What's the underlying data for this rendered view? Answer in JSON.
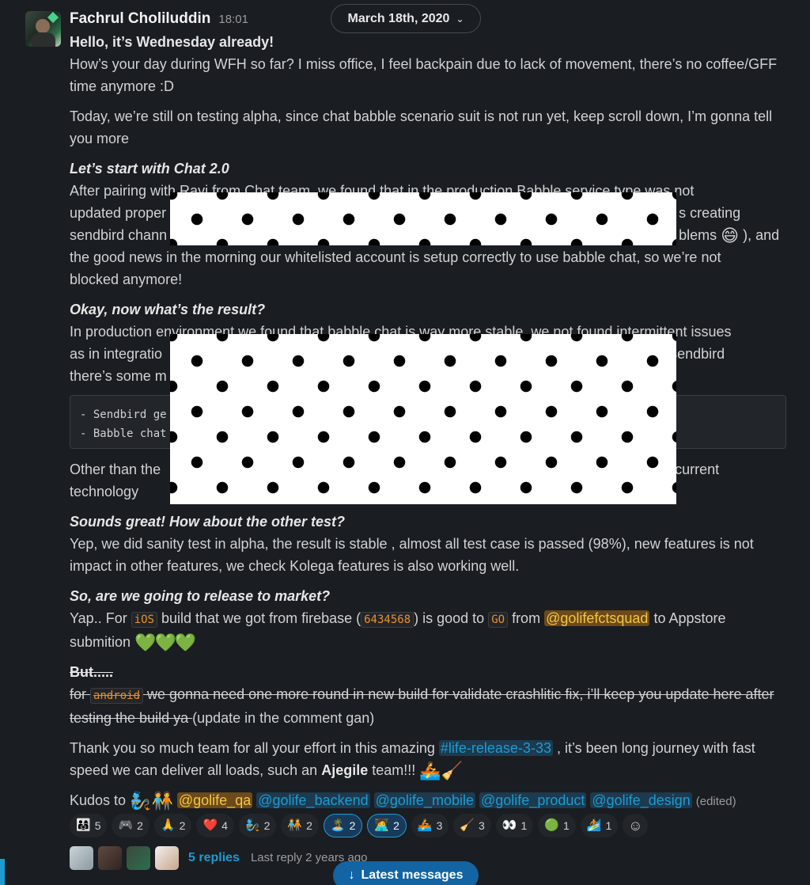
{
  "message": {
    "author": "Fachrul Choliluddin",
    "time": "18:01",
    "date_divider": "March 18th, 2020",
    "p1_title": "Hello, it’s Wednesday already!",
    "p1_text": "How’s your day during WFH so far? I miss office, I feel backpain due to lack of movement, there’s no coffee/GFF time anymore :D",
    "p2_text": "Today, we’re still on testing alpha, since chat babble scenario suit is not run yet, keep scroll down, I’m gonna tell you more",
    "s1_title": "Let’s start with Chat 2.0",
    "s1_line1": "After pairing with Ravi from Chat team, we found that in the production Babble service type was not",
    "s1_line2_left": "updated proper",
    "s1_line2_right": "s creating",
    "s1_line3_left": "sendbird chann",
    "s1_line3_right": "blems",
    "s1_line3_end": "), and",
    "s1_line4": "the good news in the morning our whitelisted account is setup correctly to use babble chat, so we’re not",
    "s1_line5": "blocked anymore!",
    "s2_title": "Okay, now what’s the result?",
    "s2_line1": "In production environment we found that babble chat is way more stable, we not found intermittent issues",
    "s2_line2_left": "as in integratio",
    "s2_line2_right": "sendbird",
    "s2_line3_left": "there’s some m",
    "code_line1": "- Sendbird ge",
    "code_line2": "- Babble chat",
    "s2_after_left": "Other than the",
    "s2_after_right": "current",
    "s2_after_line2": "technology",
    "s3_title": "Sounds great! How about the other test?",
    "s3_text": "Yep, we did sanity test in alpha, the result is stable , almost all test case is passed (98%), new features is not impact in other features, we check Kolega features is also working well.",
    "s4_title": "So, are we going to release to market?",
    "s4_a": "Yap.. For ",
    "s4_ios": "iOS",
    "s4_b": " build that we got from firebase (",
    "s4_build": "6434568",
    "s4_c": ") is good to ",
    "s4_go": "GO",
    "s4_d": " from ",
    "s4_mention": "@golifefctsquad",
    "s4_e": " to Appstore",
    "s4_f": "submition",
    "s5_title": "But.....",
    "s5_a": "for ",
    "s5_android": "android",
    "s5_b": " we gonna need one more round in new build for validate crashlitic fix, i’ll keep you update here after testing the build ya ",
    "s5_c": "(update in the comment gan)",
    "s6_a": "Thank you so much team for all your effort in this amazing ",
    "s6_channel": "#life-release-3-33",
    "s6_b": " , it’s been long journey with fast speed we can deliver all loads, such an ",
    "s6_bold": "Ajegile",
    "s6_c": " team!!!",
    "kudos_label": "Kudos to",
    "kudos_mentions": [
      "@golife_qa",
      "@golife_backend",
      "@golife_mobile",
      "@golife_product",
      "@golife_design"
    ],
    "edited": "(edited)"
  },
  "reactions": [
    {
      "icon": "👨‍👩‍👧",
      "count": "5",
      "selected": false
    },
    {
      "icon": "🎮",
      "count": "2",
      "selected": false
    },
    {
      "icon": "🙏",
      "count": "2",
      "selected": false
    },
    {
      "icon": "❤️",
      "count": "4",
      "selected": false
    },
    {
      "icon": "🧞",
      "count": "2",
      "selected": false
    },
    {
      "icon": "🧑‍🤝‍🧑",
      "count": "2",
      "selected": false
    },
    {
      "icon": "🏝️",
      "count": "2",
      "selected": true
    },
    {
      "icon": "🧑‍💻",
      "count": "2",
      "selected": true
    },
    {
      "icon": "🚣",
      "count": "3",
      "selected": false
    },
    {
      "icon": "🧹",
      "count": "3",
      "selected": false
    },
    {
      "icon": "👀",
      "count": "1",
      "selected": false
    },
    {
      "icon": "🟢",
      "count": "1",
      "selected": false
    },
    {
      "icon": "🏄",
      "count": "1",
      "selected": false
    }
  ],
  "thread": {
    "replies": "5 replies",
    "last_reply": "Last reply 2 years ago"
  },
  "latest_button": "Latest messages",
  "colors": {
    "background": "#1a1d21",
    "link": "#1d9bd1",
    "mention_bg": "#6d4a19",
    "code": "#e8912d",
    "heart": "#3fcf4c",
    "latest_button": "#1264a3"
  }
}
